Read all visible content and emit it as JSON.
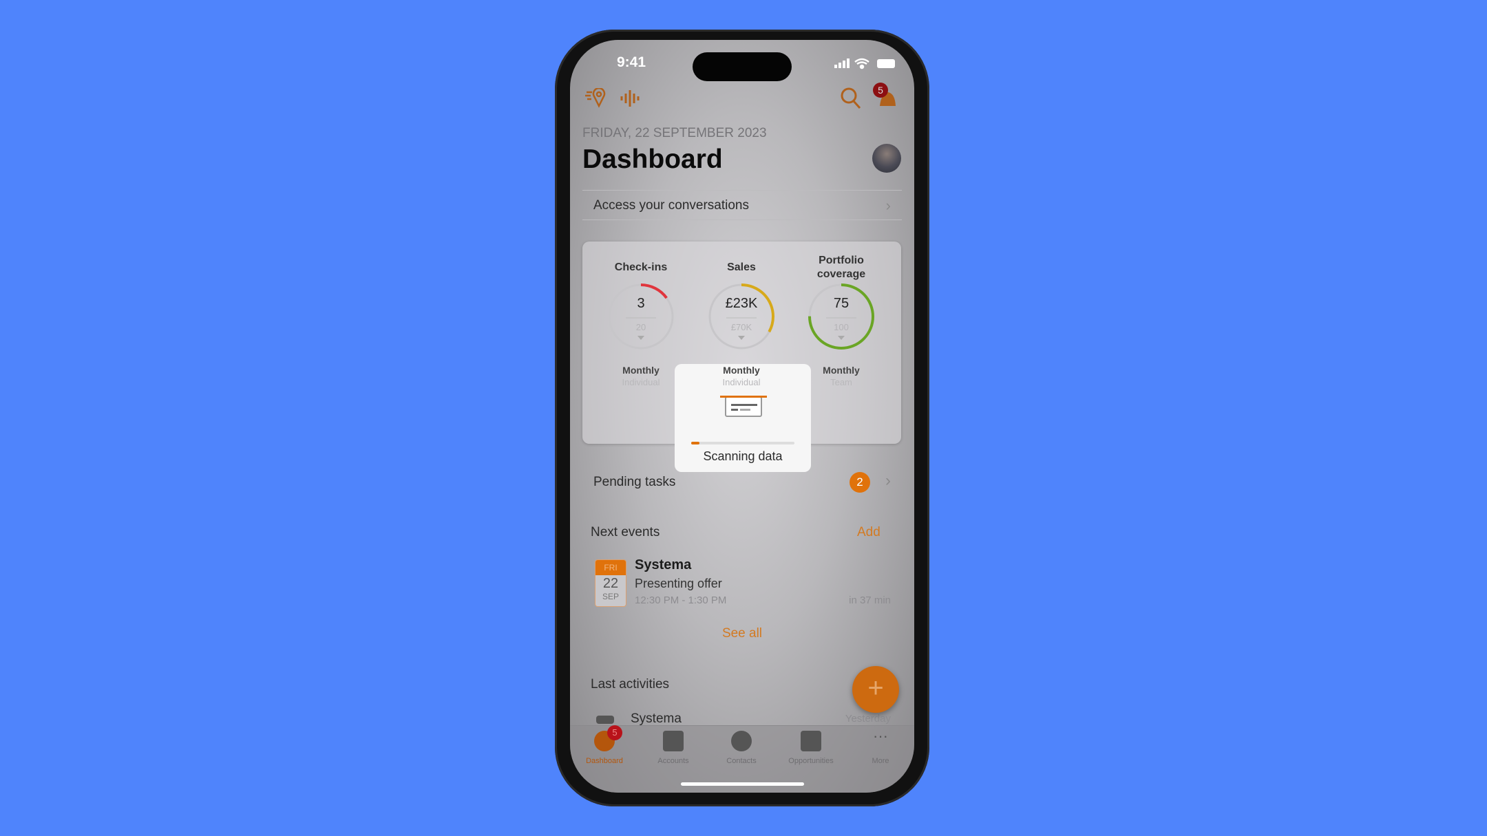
{
  "status": {
    "time": "9:41"
  },
  "header": {
    "date": "FRIDAY, 22 SEPTEMBER 2023",
    "title": "Dashboard",
    "notifications_count": "5",
    "icons": [
      "route-pin-icon",
      "voice-wave-icon",
      "search-icon",
      "bell-icon"
    ]
  },
  "conversations": {
    "label": "Access your conversations"
  },
  "stats": [
    {
      "title": "Check-ins",
      "value": "3",
      "target": "20",
      "period": "Monthly",
      "scope": "Individual",
      "progress": 0.15,
      "color": "#e0353d"
    },
    {
      "title": "Sales",
      "value": "£23K",
      "target": "£70K",
      "period": "Monthly",
      "scope": "Individual",
      "progress": 0.33,
      "color": "#d7a91a"
    },
    {
      "title": "Portfolio coverage",
      "value": "75",
      "target": "100",
      "period": "Monthly",
      "scope": "Team",
      "progress": 0.75,
      "color": "#6aa525"
    }
  ],
  "modal": {
    "label": "Scanning data",
    "progress": 0.08
  },
  "pending": {
    "label": "Pending tasks",
    "count": "2"
  },
  "events": {
    "title": "Next events",
    "add": "Add",
    "items": [
      {
        "weekday": "FRI",
        "day": "22",
        "month": "SEP",
        "name": "Systema",
        "subject": "Presenting offer",
        "time": "12:30 PM - 1:30 PM",
        "relative": "in 37 min"
      }
    ],
    "see_all": "See all"
  },
  "activities": {
    "title": "Last activities",
    "items": [
      {
        "name": "Systema",
        "when": "Yesterday"
      }
    ]
  },
  "tabs": [
    {
      "label": "Dashboard",
      "badge": "5",
      "active": true
    },
    {
      "label": "Accounts"
    },
    {
      "label": "Contacts"
    },
    {
      "label": "Opportunities"
    },
    {
      "label": "More"
    }
  ],
  "colors": {
    "accent": "#e8780e",
    "background": "#4f84fc"
  }
}
